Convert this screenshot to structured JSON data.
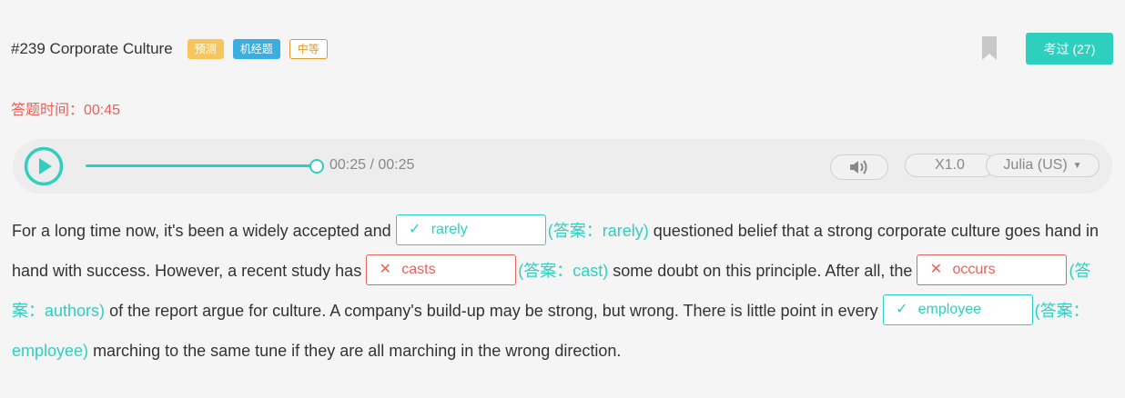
{
  "header": {
    "title": "#239 Corporate Culture",
    "tags": [
      "预测",
      "机经题",
      "中等"
    ],
    "taken_label": "考过 (27)"
  },
  "timer": "答题时间：00:45",
  "player": {
    "progress": 1.0,
    "time_label": "00:25 / 00:25",
    "speed_label": "X1.0",
    "voice_label": "Julia (US)"
  },
  "passage": {
    "t1": "For a long time now, it's been a widely accepted and",
    "b1": {
      "mark": "✓",
      "text": "rarely",
      "answer": "(答案：rarely)"
    },
    "t2": "questioned belief that a strong corporate culture goes hand in hand with success. However, a recent study has",
    "b2": {
      "mark": "✕",
      "text": "casts",
      "answer": "(答案：cast)"
    },
    "t3": "some doubt on this principle. After all, the",
    "b3": {
      "mark": "✕",
      "text": "occurs",
      "answer": "(答案：authors)"
    },
    "t4": "of the report argue for culture. A company's build-up may be strong, but wrong. There is little point in every",
    "b4": {
      "mark": "✓",
      "text": "employee",
      "answer": "(答案：employee)"
    },
    "t5": "marching to the same tune if they are all marching in the wrong direction."
  },
  "colors": {
    "accent": "#2fcfc0",
    "error": "#e8625a",
    "tag_predict": "#f7c65a",
    "tag_machine": "#3aaee0",
    "tag_medium": "#e39a2c"
  }
}
